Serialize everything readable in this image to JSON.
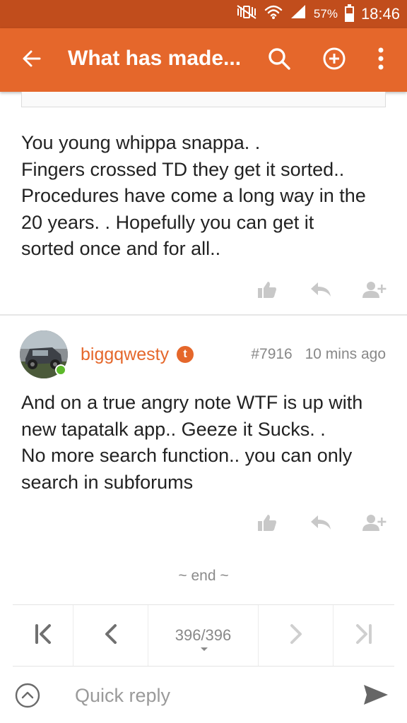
{
  "status_bar": {
    "battery_percent": "57%",
    "battery_level": 0.57,
    "time": "18:46",
    "icons": [
      "mute-vibrate-icon",
      "wifi-icon",
      "signal-icon",
      "battery-icon"
    ]
  },
  "app_bar": {
    "title": "What has made...",
    "color": "#e5672b",
    "status_color": "#c14d1c",
    "icons": [
      "back-arrow-icon",
      "search-icon",
      "add-circle-icon",
      "overflow-menu-icon"
    ]
  },
  "posts": [
    {
      "body_lines": [
        "You young whippa snappa. .",
        "Fingers crossed TD they get it sorted..",
        "Procedures have come a long way in the",
        "20 years. . Hopefully you can get it",
        "sorted once and for all.."
      ],
      "actions": [
        "like-icon",
        "reply-icon",
        "follow-user-icon"
      ]
    },
    {
      "username": "biggqwesty",
      "badge": "t",
      "post_number": "#7916",
      "time": "10 mins ago",
      "online": true,
      "body_lines": [
        "And on a true angry note WTF is up with",
        "new tapatalk app.. Geeze it Sucks. .",
        "No more search function.. you can only",
        "search in subforums"
      ],
      "actions": [
        "like-icon",
        "reply-icon",
        "follow-user-icon"
      ]
    }
  ],
  "end_marker": "~ end ~",
  "pager": {
    "page_count": "396/396",
    "icons": [
      "first-page-icon",
      "previous-page-icon",
      "next-page-icon",
      "last-page-icon"
    ]
  },
  "reply_bar": {
    "placeholder": "Quick reply",
    "icons": [
      "expand-up-icon",
      "send-icon"
    ]
  },
  "colors": {
    "accent": "#e5672b",
    "online": "#5cb82a",
    "muted_text": "#888888"
  }
}
